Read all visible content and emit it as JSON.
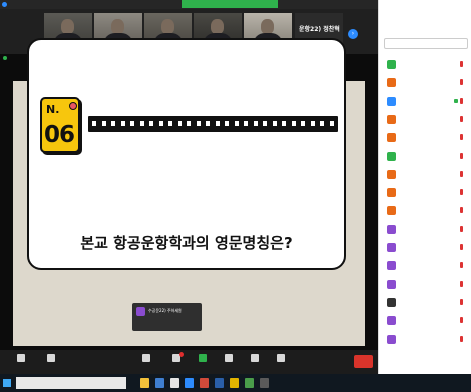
{
  "window": {
    "title": ""
  },
  "share_banner": {
    "text": "",
    "stop_label": ""
  },
  "gallery": {
    "tiles": [
      {
        "name": ""
      },
      {
        "name": ""
      },
      {
        "name": ""
      },
      {
        "name": ""
      },
      {
        "name": ""
      }
    ],
    "name_tile": {
      "name": "운항22) 정찬혁",
      "subtitle": ""
    }
  },
  "stage": {
    "label": ""
  },
  "slide": {
    "badge_prefix": "N.",
    "badge_number": "06",
    "question": "본교 항공운항학과의 영문명칭은?",
    "colors": {
      "badge": "#f7c60d",
      "dot": "#e95563",
      "paper": "#ddd8cc"
    }
  },
  "chat_toast": {
    "avatar": "",
    "sender": "수공운22) 주하세원",
    "message": ""
  },
  "toolbar": {
    "buttons": [
      {
        "label": "",
        "icon": "microphone-icon"
      },
      {
        "label": "",
        "icon": "video-camera-icon"
      },
      {
        "label": "",
        "icon": "participants-icon"
      },
      {
        "label": "",
        "icon": "chat-icon"
      },
      {
        "label": "",
        "icon": "share-screen-icon"
      },
      {
        "label": "",
        "icon": "record-icon"
      },
      {
        "label": "",
        "icon": "reactions-icon"
      },
      {
        "label": "",
        "icon": "apps-icon"
      }
    ],
    "end_label": ""
  },
  "participants_panel": {
    "title": "",
    "search_placeholder": "",
    "participants": [
      {
        "name": "",
        "color": "#2fb24c"
      },
      {
        "name": "",
        "color": "#e86a17"
      },
      {
        "name": "",
        "color": "#2d8cff"
      },
      {
        "name": "",
        "color": "#e86a17"
      },
      {
        "name": "",
        "color": "#e86a17"
      },
      {
        "name": "",
        "color": "#2fb24c"
      },
      {
        "name": "",
        "color": "#e86a17"
      },
      {
        "name": "",
        "color": "#e86a17"
      },
      {
        "name": "",
        "color": "#e86a17"
      },
      {
        "name": "",
        "color": "#8a4ccf"
      },
      {
        "name": "",
        "color": "#8a4ccf"
      },
      {
        "name": "",
        "color": "#8a4ccf"
      },
      {
        "name": "",
        "color": "#8a4ccf"
      },
      {
        "name": "",
        "color": "#333333"
      },
      {
        "name": "",
        "color": "#8a4ccf"
      },
      {
        "name": "",
        "color": "#8a4ccf"
      }
    ],
    "invite_label": "",
    "mute_all_label": ""
  },
  "taskbar": {
    "search_placeholder": "",
    "clock_time": "",
    "clock_date": ""
  }
}
